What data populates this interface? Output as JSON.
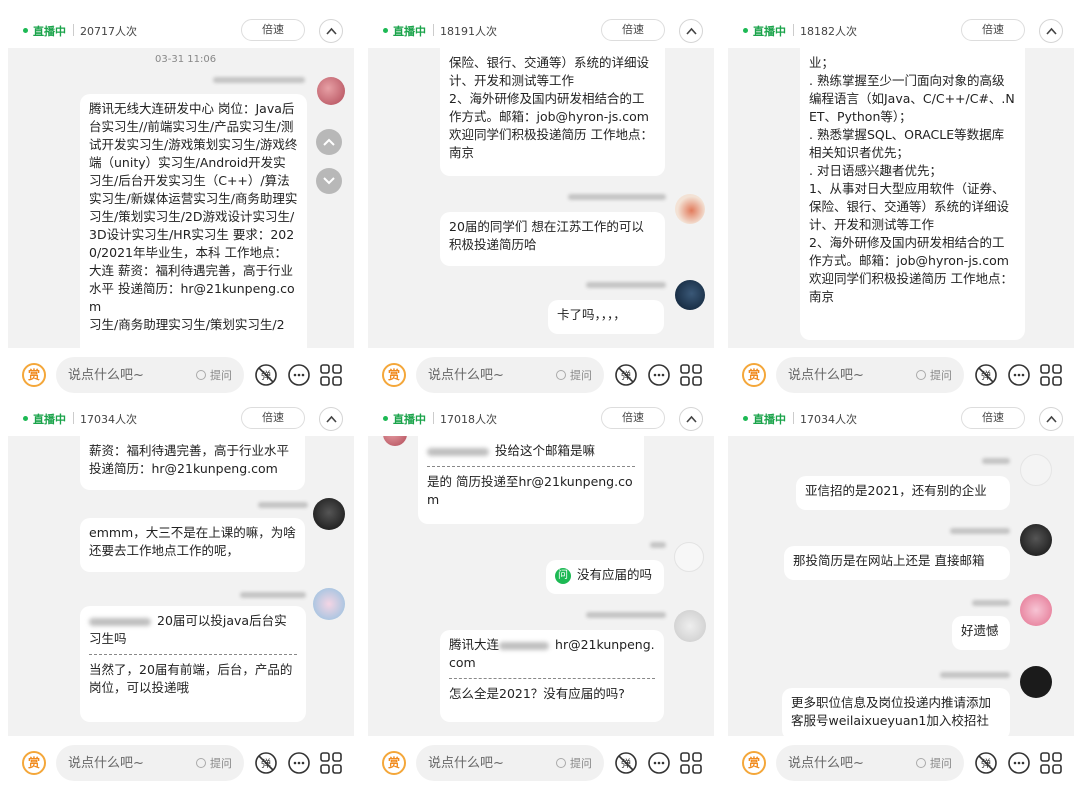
{
  "common": {
    "live_label": "直播中",
    "speed_label": "倍速",
    "input_placeholder": "说点什么吧~",
    "ask_label": "提问",
    "reward_label": "赏",
    "accent": "#1aa34a",
    "reward_color": "#f08a1d"
  },
  "panels": [
    {
      "viewers": "20717人次",
      "timestamp": "03-31 11:06",
      "messages": [
        {
          "text": "腾讯无线大连研发中心 岗位：Java后台实习生//前端实习生/产品实习生/测试开发实习生/游戏策划实习生/游戏终端（unity）实习生/Android开发实习生/后台开发实习生（C++）/算法实习生/新媒体运营实习生/商务助理实习生/策划实习生/2D游戏设计实习生/3D设计实习生/HR实习生 要求：2020/2021年毕业生，本科 工作地点：大连 薪资：福利待遇完善，高于行业水平 投递简历：hr@21kunpeng.com\n习生/商务助理实习生/策划实习生/2"
        }
      ]
    },
    {
      "viewers": "18191人次",
      "messages": [
        {
          "text": "保险、银行、交通等）系统的详细设计、开发和测试等工作\n2、海外研修及国内研发相结合的工作方式。邮箱：job@hyron-js.com\n欢迎同学们积极投递简历 工作地点：南京"
        },
        {
          "text": "20届的同学们 想在江苏工作的可以积极投递简历哈"
        },
        {
          "text": "卡了吗，，，，"
        }
      ]
    },
    {
      "viewers": "18182人次",
      "messages": [
        {
          "text": "业；\n. 熟练掌握至少一门面向对象的高级编程语言（如Java、C/C++/C#、.NET、Python等）；\n. 熟悉掌握SQL、ORACLE等数据库相关知识者优先；\n. 对日语感兴趣者优先；\n1、从事对日大型应用软件（证券、保险、银行、交通等）系统的详细设计、开发和测试等工作\n2、海外研修及国内研发相结合的工作方式。邮箱：job@hyron-js.com\n欢迎同学们积极投递简历 工作地点：南京"
        }
      ]
    },
    {
      "viewers": "17034人次",
      "messages": [
        {
          "text": "薪资：福利待遇完善，高于行业水平 投递简历：hr@21kunpeng.com"
        },
        {
          "text": "emmm，大三不是在上课的嘛，为啥还要去工作地点工作的呢，"
        },
        {
          "question": "20届可以投java后台实习生吗",
          "answer": "当然了，20届有前端，后台，产品的岗位，可以投递哦"
        }
      ]
    },
    {
      "viewers": "17018人次",
      "messages": [
        {
          "question": "投给这个邮箱是嘛",
          "answer": "是的 简历投递至hr@21kunpeng.com"
        },
        {
          "badge": "问",
          "text": "没有应届的吗"
        },
        {
          "question_prefix": "腾讯大连",
          "question_suffix": "hr@21kunpeng.com",
          "answer": "怎么全是2021？没有应届的吗?"
        }
      ]
    },
    {
      "viewers": "17034人次",
      "messages": [
        {
          "text": "亚信招的是2021，还有别的企业"
        },
        {
          "text": "那投简历是在网站上还是 直接邮箱"
        },
        {
          "text": "好遗憾"
        },
        {
          "text": "更多职位信息及岗位投递内推请添加客服号weilaixueyuan1加入校招社"
        }
      ]
    }
  ]
}
